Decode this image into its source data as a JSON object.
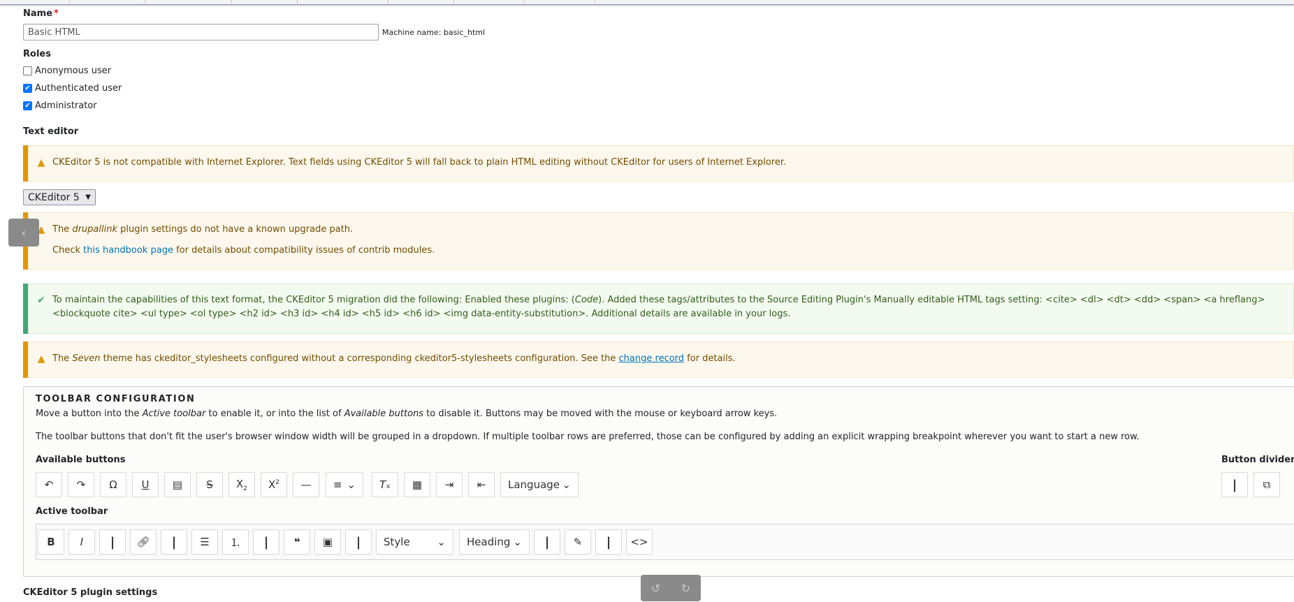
{
  "name": {
    "label": "Name",
    "required_mark": "*",
    "value": "Basic HTML",
    "machine_name": "Machine name: basic_html"
  },
  "roles": {
    "label": "Roles",
    "items": [
      {
        "label": "Anonymous user",
        "checked": false
      },
      {
        "label": "Authenticated user",
        "checked": true
      },
      {
        "label": "Administrator",
        "checked": true
      }
    ]
  },
  "text_editor": {
    "label": "Text editor",
    "selected": "CKEditor 5"
  },
  "messages": {
    "ie_warning": "CKEditor 5 is not compatible with Internet Explorer. Text fields using CKEditor 5 will fall back to plain HTML editing without CKEditor for users of Internet Explorer.",
    "drupallink": {
      "pre": "The ",
      "plugin": "drupallink",
      "post": " plugin settings do not have a known upgrade path.",
      "line2_pre": "Check ",
      "link": "this handbook page",
      "line2_post": " for details about compatibility issues of contrib modules."
    },
    "migration": {
      "pre": "To maintain the capabilities of this text format, the CKEditor 5 migration did the following: Enabled these plugins: (",
      "code": "Code",
      "post": "). Added these tags/attributes to the Source Editing Plugin's Manually editable HTML tags setting: <cite> <dl> <dt> <dd> <span> <a hreflang>",
      "line2": "<blockquote cite> <ul type> <ol type> <h2 id> <h3 id> <h4 id> <h5 id> <h6 id> <img data-entity-substitution>. Additional details are available in your logs."
    },
    "theme": {
      "pre": "The ",
      "theme": "Seven",
      "mid": " theme has ckeditor_stylesheets configured without a corresponding ckeditor5-stylesheets configuration. See the ",
      "link": "change record",
      "post": " for details."
    }
  },
  "toolbar_config": {
    "title": "TOOLBAR CONFIGURATION",
    "p1_pre": "Move a button into the ",
    "p1_em1": "Active toolbar",
    "p1_mid": " to enable it, or into the list of ",
    "p1_em2": "Available buttons",
    "p1_post": " to disable it. Buttons may be moved with the mouse or keyboard arrow keys.",
    "p2": "The toolbar buttons that don't fit the user's browser window width will be grouped in a dropdown. If multiple toolbar rows are preferred, those can be configured by adding an explicit wrapping breakpoint wherever you want to start a new row.",
    "available_label": "Available buttons",
    "divider_label": "Button divider",
    "active_label": "Active toolbar",
    "language_label": "Language",
    "style_label": "Style",
    "heading_label": "Heading"
  },
  "plugin_settings_label": "CKEditor 5 plugin settings",
  "colors": {
    "warning": "#e29700",
    "status": "#42a877",
    "link": "#0071b8"
  }
}
